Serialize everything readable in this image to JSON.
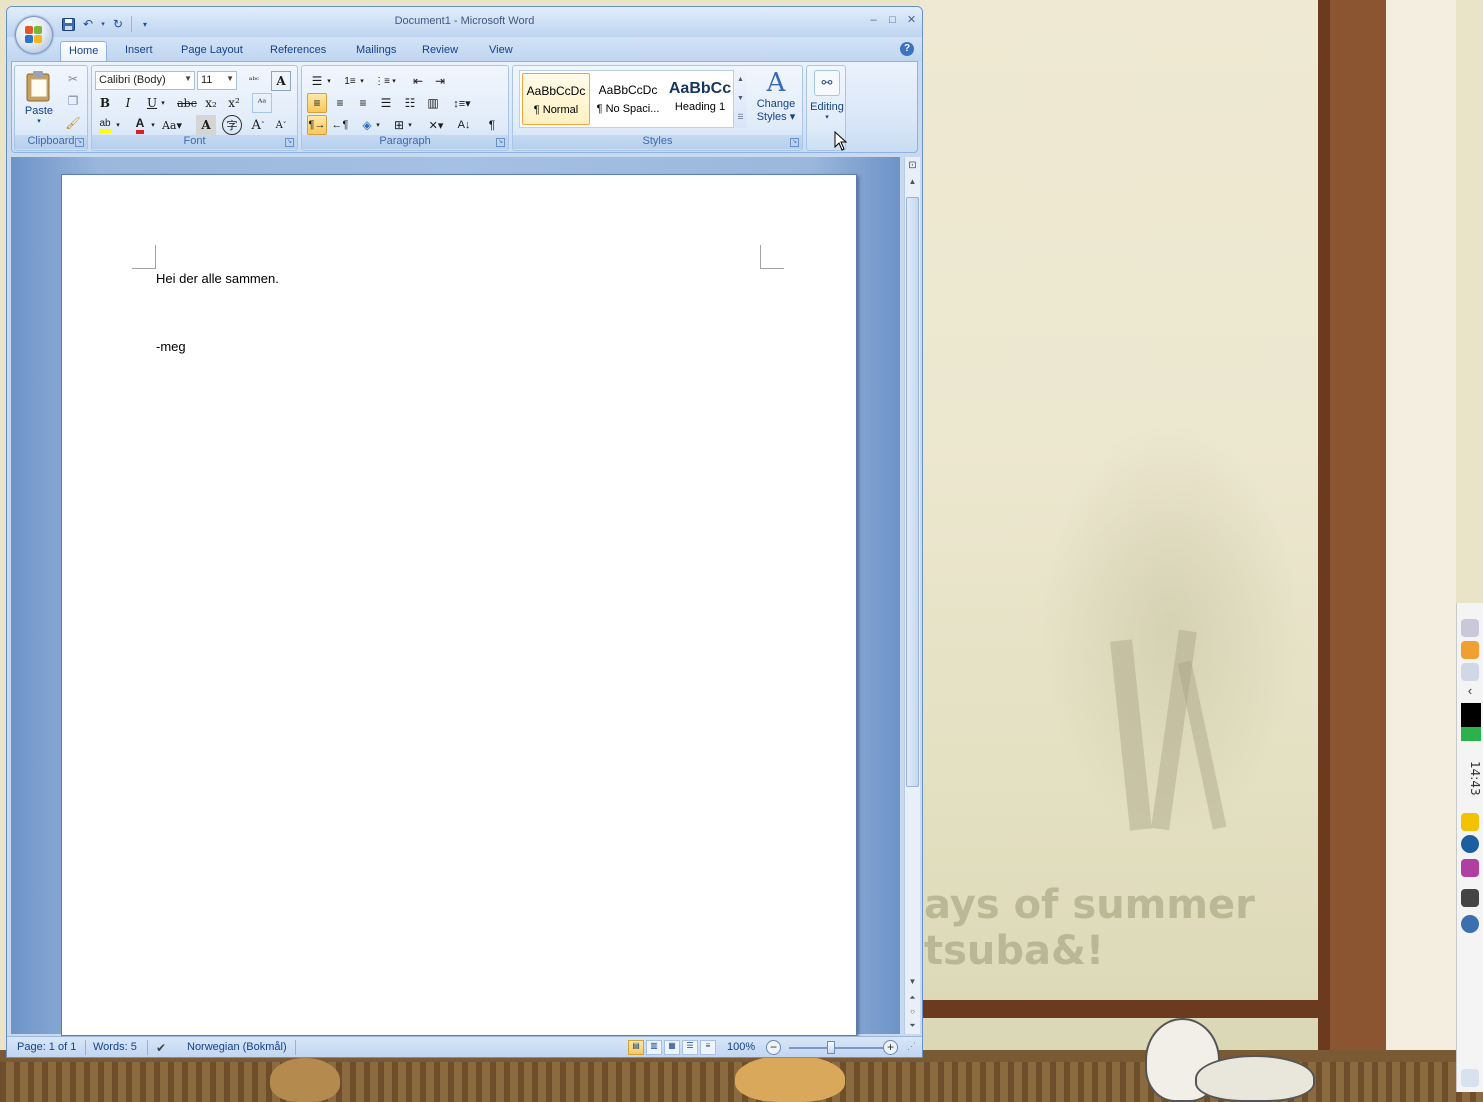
{
  "window": {
    "title": "Document1 - Microsoft Word"
  },
  "qat": {
    "items": [
      "save-icon",
      "undo-icon",
      "redo-icon",
      "customize-icon"
    ]
  },
  "tabs": [
    "Home",
    "Insert",
    "Page Layout",
    "References",
    "Mailings",
    "Review",
    "View"
  ],
  "active_tab": "Home",
  "ribbon": {
    "clipboard": {
      "label": "Clipboard",
      "paste_label": "Paste"
    },
    "font": {
      "label": "Font",
      "font_name": "Calibri (Body)",
      "font_size": "11"
    },
    "paragraph": {
      "label": "Paragraph"
    },
    "styles": {
      "label": "Styles",
      "items": [
        {
          "sample": "AaBbCcDc",
          "name": "¶ Normal"
        },
        {
          "sample": "AaBbCcDc",
          "name": "¶ No Spaci..."
        },
        {
          "sample": "AaBbCc",
          "name": "Heading 1"
        }
      ],
      "change_styles_line1": "Change",
      "change_styles_line2": "Styles"
    },
    "editing": {
      "label": "Editing"
    }
  },
  "document": {
    "lines": [
      "Hei der alle sammen.",
      "-meg"
    ]
  },
  "status": {
    "page": "Page: 1 of 1",
    "words": "Words: 5",
    "language": "Norwegian (Bokmål)",
    "zoom": "100%"
  },
  "desktop": {
    "wallpaper_line1": "ays of summer",
    "wallpaper_line2": "tsuba&!",
    "clock": "14:43"
  },
  "colors": {
    "ribbon_blue": "#dbe8f8",
    "selected_gold": "#f8c85b",
    "font_color_red": "#e02020",
    "highlight_yellow": "#ffff00"
  }
}
